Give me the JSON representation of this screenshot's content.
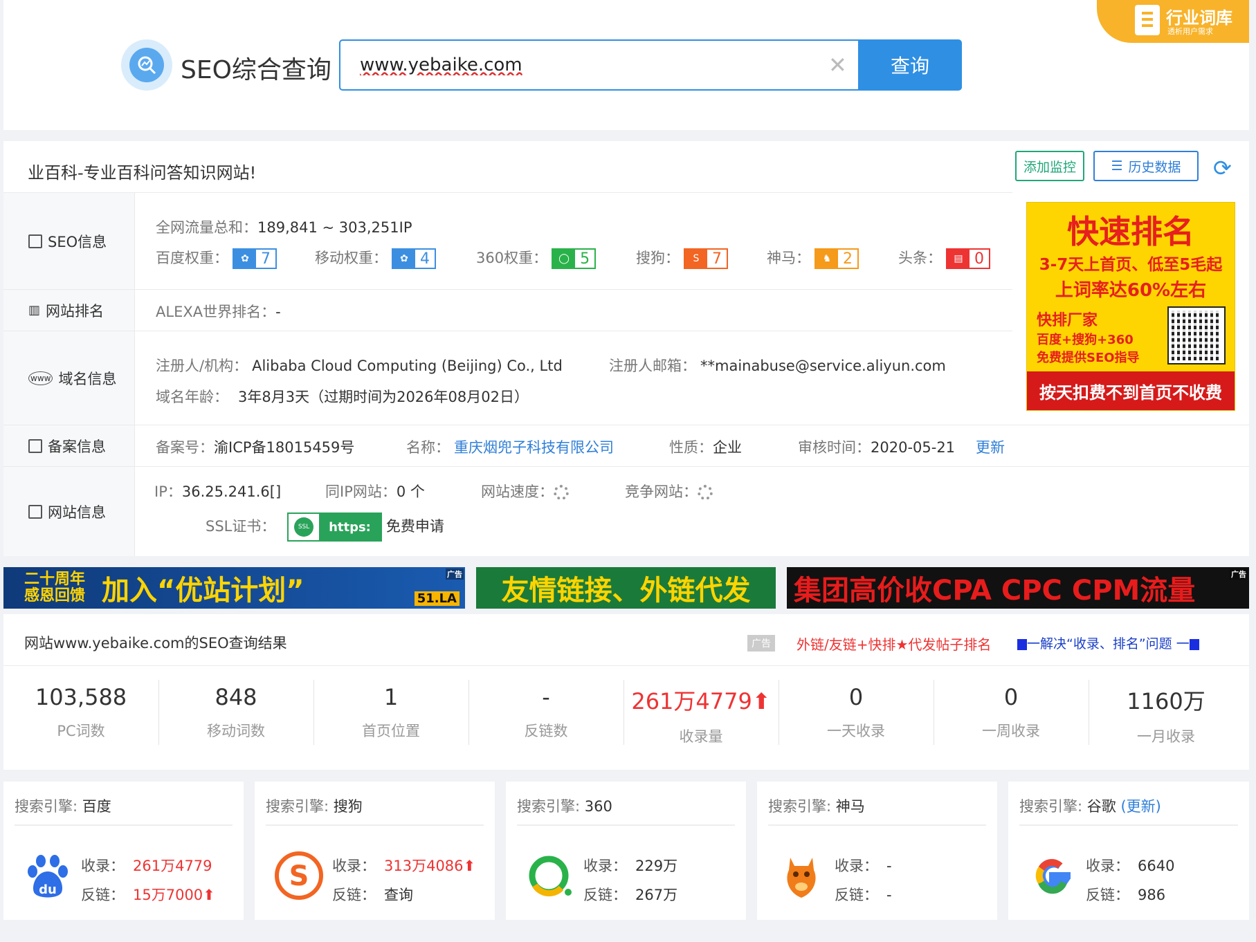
{
  "header": {
    "logo_text": "SEO综合查询",
    "search_value": "www.yebaike.com",
    "search_button": "查询",
    "corner_title": "行业词库",
    "corner_sub": "透析用户需求"
  },
  "site": {
    "title": "业百科-专业百科问答知识网站!",
    "btn_monitor": "添加监控",
    "btn_history": "历史数据"
  },
  "seo": {
    "label": "SEO信息",
    "traffic_label": "全网流量总和：",
    "traffic_value": "189,841 ~ 303,251IP",
    "weights": [
      {
        "label": "百度权重：",
        "value": "7",
        "icon": "baidu-paw",
        "color": "#3c8fe0"
      },
      {
        "label": "移动权重：",
        "value": "4",
        "icon": "baidu-paw",
        "color": "#3c8fe0"
      },
      {
        "label": "360权重：",
        "value": "5",
        "icon": "360-ring",
        "color": "#2ab24a"
      },
      {
        "label": "搜狗：",
        "value": "7",
        "icon": "sogou-s",
        "color": "#f26522"
      },
      {
        "label": "神马：",
        "value": "2",
        "icon": "shenma",
        "color": "#f59a1a"
      },
      {
        "label": "头条：",
        "value": "0",
        "icon": "toutiao",
        "color": "#e33"
      }
    ]
  },
  "rank": {
    "label": "网站排名",
    "alexa_label": "ALEXA世界排名：",
    "alexa_value": "-"
  },
  "domain": {
    "label": "域名信息",
    "registrant_label": "注册人/机构：",
    "registrant_value": "Alibaba Cloud Computing (Beijing) Co., Ltd",
    "email_label": "注册人邮箱：",
    "email_value": "**mainabuse@service.aliyun.com",
    "age_label": "域名年龄：",
    "age_value": "3年8月3天（过期时间为2026年08月02日）"
  },
  "icp": {
    "label": "备案信息",
    "num_label": "备案号：",
    "num_value": "渝ICP备18015459号",
    "name_label": "名称：",
    "name_value": "重庆烟兜子科技有限公司",
    "type_label": "性质：",
    "type_value": "企业",
    "time_label": "审核时间：",
    "time_value": "2020-05-21",
    "update": "更新"
  },
  "webinfo": {
    "label": "网站信息",
    "ip_label": "IP：",
    "ip_value": "36.25.241.6[]",
    "sameip_label": "同IP网站：",
    "sameip_value": "0 个",
    "speed_label": "网站速度：",
    "compete_label": "竞争网站：",
    "ssl_label": "SSL证书：",
    "ssl_badge": "https:",
    "ssl_apply": "免费申请"
  },
  "ad_box": {
    "l1": "快速排名",
    "l2": "3-7天上首页、低至5毛起",
    "l3": "上词率达60%左右",
    "l4": "快排厂家",
    "l5": "百度+搜狗+360",
    "l6": "免费提供SEO指导",
    "l7": "按天扣费不到首页不收费"
  },
  "banners": {
    "b1_small1": "二十周年",
    "b1_small2": "感恩回馈",
    "b1_main": "加入“优站计划”",
    "b1_brand": "51.LA",
    "b2": "友情链接、外链代发",
    "b3": "集团高价收CPA CPC CPM流量",
    "ad_tag": "广告"
  },
  "results": {
    "title": "网站www.yebaike.com的SEO查询结果",
    "ad_tag": "广告",
    "red_link": "外链/友链+快排★代发帖子排名",
    "blue_link": "一解决“收录、排名”问题 一",
    "stats": [
      {
        "value": "103,588",
        "label": "PC词数"
      },
      {
        "value": "848",
        "label": "移动词数"
      },
      {
        "value": "1",
        "label": "首页位置"
      },
      {
        "value": "-",
        "label": "反链数"
      },
      {
        "value": "261万4779⬆",
        "label": "收录量"
      },
      {
        "value": "0",
        "label": "一天收录"
      },
      {
        "value": "0",
        "label": "一周收录"
      },
      {
        "value": "1160万",
        "label": "一月收录"
      }
    ]
  },
  "engines": [
    {
      "prefix": "搜索引擎:",
      "name": "百度",
      "upd": "",
      "icon": "baidu-logo",
      "sl_label": "收录：",
      "sl": "261万4779",
      "fl_label": "反链：",
      "fl": "15万7000⬆"
    },
    {
      "prefix": "搜索引擎:",
      "name": "搜狗",
      "upd": "",
      "icon": "sogou-logo",
      "sl_label": "收录：",
      "sl": "313万4086⬆",
      "fl_label": "反链：",
      "fl": "查询"
    },
    {
      "prefix": "搜索引擎:",
      "name": "360",
      "upd": "",
      "icon": "360-logo",
      "sl_label": "收录：",
      "sl": "229万",
      "fl_label": "反链：",
      "fl": "267万"
    },
    {
      "prefix": "搜索引擎:",
      "name": "神马",
      "upd": "",
      "icon": "shenma-logo",
      "sl_label": "收录：",
      "sl": "-",
      "fl_label": "反链：",
      "fl": "-"
    },
    {
      "prefix": "搜索引擎:",
      "name": "谷歌",
      "upd": "(更新)",
      "icon": "google-logo",
      "sl_label": "收录：",
      "sl": "6640",
      "fl_label": "反链：",
      "fl": "986"
    }
  ]
}
